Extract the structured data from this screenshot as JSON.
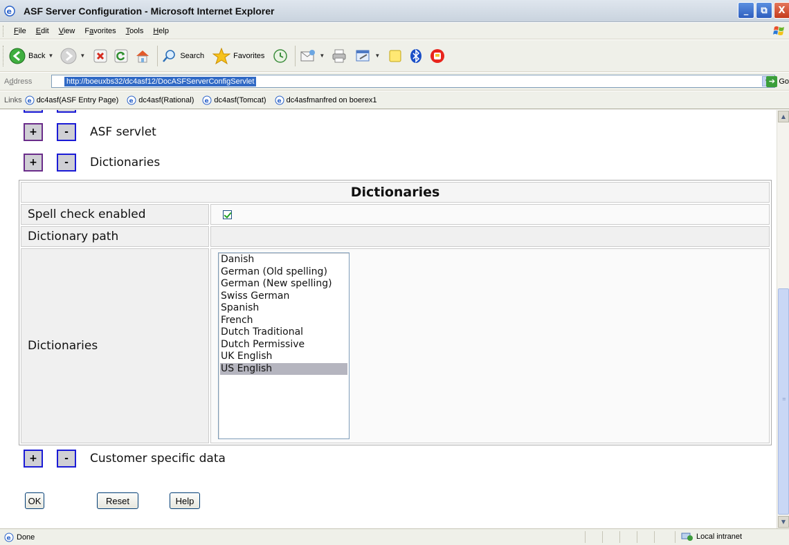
{
  "window": {
    "title": "ASF Server Configuration - Microsoft Internet Explorer",
    "minimize": "_",
    "maximize": "⧉",
    "close": "X"
  },
  "menu": {
    "items": [
      {
        "label": "File",
        "accel": "F",
        "rest": "ile"
      },
      {
        "label": "Edit",
        "accel": "E",
        "rest": "dit"
      },
      {
        "label": "View",
        "accel": "V",
        "rest": "iew"
      },
      {
        "label": "Favorites",
        "pre": "F",
        "accel": "a",
        "rest": "vorites"
      },
      {
        "label": "Tools",
        "accel": "T",
        "rest": "ools"
      },
      {
        "label": "Help",
        "accel": "H",
        "rest": "elp"
      }
    ]
  },
  "toolbar": {
    "back_label": "Back",
    "search_label": "Search",
    "favorites_label": "Favorites"
  },
  "address": {
    "label_pre": "A",
    "label_accel": "d",
    "label_rest": "dress",
    "url": "http://boeuxbs32/dc4asf12/DocASFServerConfigServlet",
    "go_label": "Go"
  },
  "links": {
    "label": "Links",
    "items": [
      "dc4asf(ASF Entry Page)",
      "dc4asf(Rational)",
      "dc4asf(Tomcat)",
      "dc4asfmanfred on boerex1"
    ]
  },
  "sections": {
    "asf_servlet": "ASF servlet",
    "dictionaries": "Dictionaries",
    "customer_specific": "Customer specific data",
    "plus": "+",
    "minus": "-"
  },
  "config_table": {
    "header": "Dictionaries",
    "rows": {
      "spell_check_label": "Spell check enabled",
      "spell_check_checked": true,
      "dictionary_path_label": "Dictionary path",
      "dictionary_path_value": "",
      "dictionaries_label": "Dictionaries"
    },
    "dictionary_options": [
      "Danish",
      "German (Old spelling)",
      "German (New spelling)",
      "Swiss German",
      "Spanish",
      "French",
      "Dutch Traditional",
      "Dutch Permissive",
      "UK English",
      "US English"
    ],
    "selected_option": "US English"
  },
  "buttons": {
    "ok": "OK",
    "reset": "Reset",
    "help": "Help"
  },
  "status": {
    "text": "Done",
    "zone": "Local intranet"
  }
}
